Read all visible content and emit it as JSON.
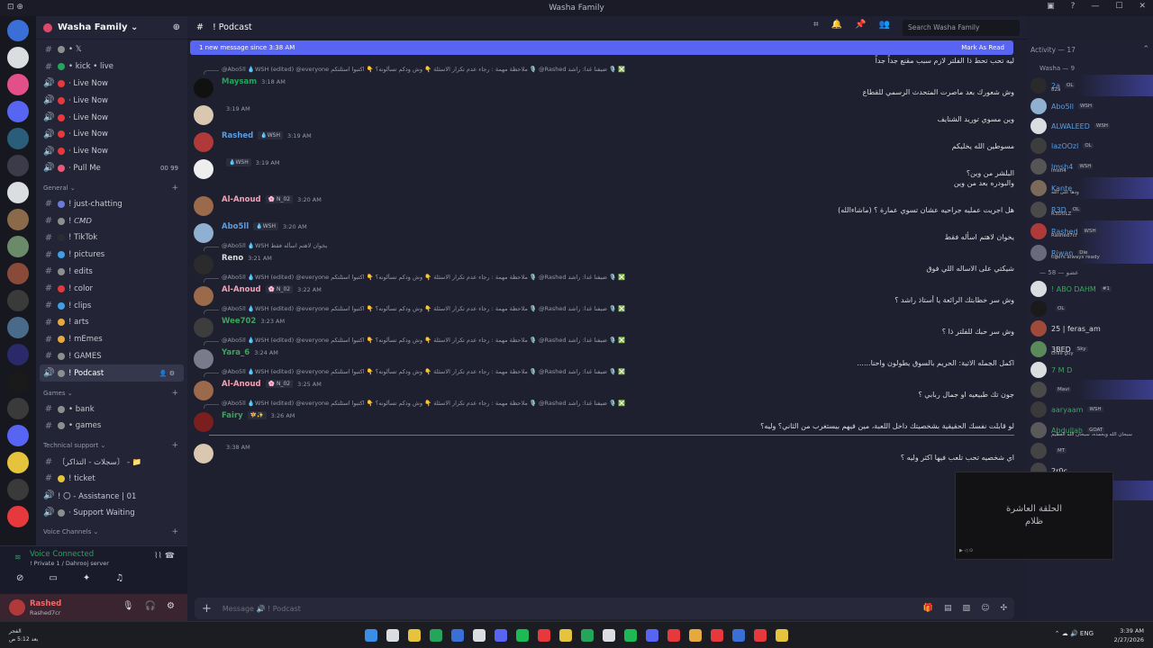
{
  "window": {
    "title": "Washa Family",
    "left_icons": "⊡ ⊕"
  },
  "header": {
    "channel": "! Podcast",
    "search_placeholder": "Search Washa Family"
  },
  "new_messages": {
    "text": "1 new message since 3:38 AM",
    "action": "Mark As Read"
  },
  "guild": {
    "name": "Washa Family ⌄"
  },
  "channels_top": [
    {
      "icon": "#",
      "label": "• 𝕏",
      "emoji": "#8e8e8e"
    },
    {
      "icon": "#",
      "label": "• kick • live",
      "emoji": "#23a55a"
    },
    {
      "icon": "🔊",
      "label": "· Live Now",
      "emoji": "#e5393d"
    },
    {
      "icon": "🔊",
      "label": "· Live Now",
      "emoji": "#e5393d"
    },
    {
      "icon": "🔊",
      "label": "· Live Now",
      "emoji": "#e5393d"
    },
    {
      "icon": "🔊",
      "label": "· Live Now",
      "emoji": "#e5393d"
    },
    {
      "icon": "🔊",
      "label": "· Live Now",
      "emoji": "#e5393d"
    },
    {
      "icon": "🔊",
      "label": "· Pull Me",
      "emoji": "#e75a78",
      "tail": "00  99"
    }
  ],
  "cat_general": "General ⌄",
  "channels_general": [
    {
      "icon": "#",
      "label": "! just-chatting",
      "emoji": "#6c7bd8"
    },
    {
      "icon": "#",
      "label": "! 𝘊𝘔𝘋",
      "emoji": "#8e8e8e"
    },
    {
      "icon": "#",
      "label": "! TikTok",
      "emoji": "#2b2d31"
    },
    {
      "icon": "#",
      "label": "! pictures",
      "emoji": "#3ba0e5"
    },
    {
      "icon": "#",
      "label": "! edits",
      "emoji": "#8e8e8e"
    },
    {
      "icon": "#",
      "label": "! color",
      "emoji": "#e5393d"
    },
    {
      "icon": "#",
      "label": "! clips",
      "emoji": "#3ba0e5"
    },
    {
      "icon": "#",
      "label": "! arts",
      "emoji": "#e5a93d"
    },
    {
      "icon": "#",
      "label": "! mEmes",
      "emoji": "#e5a93d"
    },
    {
      "icon": "#",
      "label": "! GAMES",
      "emoji": "#8e8e8e"
    },
    {
      "icon": "🔊",
      "label": "! Podcast",
      "emoji": "#8e8e8e",
      "active": true
    }
  ],
  "cat_games": "Games ⌄",
  "channels_games": [
    {
      "icon": "#",
      "label": "• bank",
      "emoji": "#8e8e8e"
    },
    {
      "icon": "#",
      "label": "• games",
      "emoji": "#8e8e8e"
    }
  ],
  "cat_support": "Technical support ⌄",
  "channels_support": [
    {
      "icon": "#",
      "label": "〔سجلات - التذاكر〕 - 📁",
      "emoji": ""
    },
    {
      "icon": "#",
      "label": "! ticket",
      "emoji": "#e5c33d"
    },
    {
      "icon": "🔊",
      "label": "! 〇 - Assistance | 01",
      "emoji": ""
    },
    {
      "icon": "🔊",
      "label": "· Support Waiting",
      "emoji": "#8e8e8e"
    }
  ],
  "cat_voice": "Voice Channels ⌄",
  "voice": {
    "title": "Voice Connected",
    "sub": "! Private 1 / Dahrooj server"
  },
  "user": {
    "name": "Rashed",
    "status": "Rashed7cr"
  },
  "messages": [
    {
      "kind": "cont",
      "text": "ليه تحب تحط ذا الفلتر لازم سبب مقنع جداً جداً"
    },
    {
      "kind": "msg",
      "reply": true,
      "name": "Maysam",
      "color": "#23a55a",
      "tags": [],
      "time": "3:18 AM",
      "avatar": "#111111",
      "text": "وش شعورك بعد ماصرت المتحدث الرسمي للقطاع"
    },
    {
      "kind": "msg",
      "reply": false,
      "name": "",
      "color": "#dbdee1",
      "tags": [],
      "time": "3:19 AM",
      "avatar": "#d9c7b0",
      "text": "وين مسوي توريد الشنايف"
    },
    {
      "kind": "msg",
      "reply": false,
      "name": "Rashed",
      "color": "#5c9ddd",
      "tags": [
        "💧WSH"
      ],
      "time": "3:19 AM",
      "avatar": "#b03a3a",
      "text": "مسوطين الله يخليكم"
    },
    {
      "kind": "msg",
      "reply": false,
      "name": "",
      "color": "#e5393d",
      "tags": [
        "💧WSH"
      ],
      "time": "3:19 AM",
      "avatar": "#eeeeee",
      "text": "البلشر من وين؟",
      "text2": "والبودره بعد من وين"
    },
    {
      "kind": "msg",
      "reply": false,
      "name": "Al-Anoud",
      "color": "#f0a3b5",
      "tags": [
        "🌸 N_02"
      ],
      "time": "3:20 AM",
      "avatar": "#9b6a4a",
      "text": "هل اجريت عمليه جراحيه عشان تسوي عمارة ؟ (ماشاءالله)"
    },
    {
      "kind": "msg",
      "reply": false,
      "name": "Abo5ll",
      "color": "#5c9ddd",
      "tags": [
        "💧WSH"
      ],
      "time": "3:20 AM",
      "avatar": "#8fb0d0",
      "text": "يخوان لاهتم اسأله فقط"
    },
    {
      "kind": "msg",
      "reply": true,
      "replyText": "@Abo5ll 💧WSH يخوان لاهتم اسأله فقط",
      "name": "Reno",
      "color": "#dbdee1",
      "tags": [],
      "time": "3:21 AM",
      "avatar": "#2b2b2b",
      "text": "شيكتي على الاساله اللي فوق"
    },
    {
      "kind": "msg",
      "reply": true,
      "name": "Al-Anoud",
      "color": "#f0a3b5",
      "tags": [
        "🌸 N_02"
      ],
      "time": "3:22 AM",
      "avatar": "#9b6a4a",
      "text": "وش سر خطابتك الرائعة يا أستاذ راشد ؟"
    },
    {
      "kind": "msg",
      "reply": true,
      "name": "Wee702",
      "color": "#3ba55c",
      "tags": [],
      "time": "3:23 AM",
      "avatar": "#3d3d3d",
      "text": "وش سر حبك للفلتر ذا ؟"
    },
    {
      "kind": "msg",
      "reply": true,
      "name": "Yara_6",
      "color": "#3ba55c",
      "tags": [],
      "time": "3:24 AM",
      "avatar": "#7a7a8a",
      "text": "اكمل الجمله الاتية: الحريم بالسوق يطولون واحنا......"
    },
    {
      "kind": "msg",
      "reply": true,
      "name": "Al-Anoud",
      "color": "#f0a3b5",
      "tags": [
        "🌸 N_02"
      ],
      "time": "3:25 AM",
      "avatar": "#9b6a4a",
      "text": "جون تك طبيعيه او جمال ربابي ؟"
    },
    {
      "kind": "msg",
      "reply": true,
      "name": "Fairy",
      "color": "#3ba55c",
      "tags": [
        "🧚✨"
      ],
      "time": "3:26 AM",
      "avatar": "#7a1e1e",
      "text": "لو قابلت نفسك الحقيقية بشخصيتك داخل اللعبة، مين فيهم بيستغرب من الثاني؟ وليه؟"
    },
    {
      "kind": "msg",
      "reply": false,
      "name": "",
      "color": "#dbdee1",
      "tags": [],
      "time": "3:38 AM",
      "avatar": "#d9c7b0",
      "text": "اي شخصيه تحب تلعب فيها اكثر وليه ؟",
      "divider": true
    }
  ],
  "reply_default": "@Abo5ll 💧WSH (edited) @everyone ملاحظة مهمة : رجاء عدم تكرار الاسئلة 👇 وش ودكم تسألونه؟ 👇 اكتبوا اسئلتكم 🎙️ @Rashed ضيفنا غدا: راشد 🎙️ ❎",
  "composer": {
    "placeholder": "Message 🔊 ! Podcast"
  },
  "members_header": "Activity — 17",
  "role1": "Washa — 9",
  "members1": [
    {
      "name": "2a",
      "tag": "OL",
      "color": "#5c9ddd",
      "status": "82a",
      "av": "#2a2a2a",
      "boost": true
    },
    {
      "name": "Abo5ll",
      "tag": "WSH",
      "color": "#5c9ddd",
      "status": "",
      "av": "#8fb0d0"
    },
    {
      "name": "ALWALEED",
      "tag": "WSH",
      "color": "#5c9ddd",
      "status": "",
      "av": "#dbdee1"
    },
    {
      "name": "lazOOzl",
      "tag": "OL",
      "color": "#5c9ddd",
      "status": "",
      "av": "#3d3d3d"
    },
    {
      "name": "lmsh4",
      "tag": "WSH",
      "color": "#5c9ddd",
      "status": "lmsh4",
      "av": "#555555"
    },
    {
      "name": "Kante",
      "tag": "",
      "color": "#5c9ddd",
      "status": "ودها على الله",
      "av": "#7a6a5a",
      "boost": true
    },
    {
      "name": "R3D",
      "tag": "OL",
      "color": "#5c9ddd",
      "status": "R3DULZ",
      "av": "#4a4a4a"
    },
    {
      "name": "Rashed",
      "tag": "WSH",
      "color": "#5c9ddd",
      "status": "Rashed7cr",
      "av": "#b03a3a",
      "boost": true
    },
    {
      "name": "Rjwan",
      "tag": "Die",
      "color": "#5c9ddd",
      "status": "tigers always ready",
      "av": "#6a6a7a",
      "boost": true
    }
  ],
  "role2": "— عضو — 58",
  "members2": [
    {
      "name": "! ABO DAHM",
      "tag": "#1",
      "color": "#3ba55c",
      "status": "",
      "av": "#dbdee1"
    },
    {
      "name": "",
      "tag": "OL",
      "color": "#5865f2",
      "status": "",
      "av": "#1a1a1a"
    },
    {
      "name": "25 | feras_am",
      "tag": "",
      "color": "#dbdee1",
      "status": "",
      "av": "#a04a3a"
    },
    {
      "name": "3BED",
      "tag": "Sky",
      "color": "#dbdee1",
      "status": "chilli guy",
      "av": "#5a8a5a"
    },
    {
      "name": "7 M D",
      "tag": "",
      "color": "#3ba55c",
      "status": "",
      "av": "#dbdee1"
    },
    {
      "name": "",
      "tag": "Mavi",
      "color": "#5865f2",
      "status": "",
      "av": "#4a4a4a",
      "boost": true
    },
    {
      "name": "aaryaam",
      "tag": "WSH",
      "color": "#3ba55c",
      "status": "",
      "av": "#3a3a3a"
    },
    {
      "name": "Abdullah",
      "tag": "GOAT",
      "color": "#3ba55c",
      "status": "سبحان الله وبحمده، سبحان الله العظيم",
      "av": "#5a5a5a"
    },
    {
      "name": "",
      "tag": "MT",
      "color": "#3ba55c",
      "status": "",
      "av": "#444444"
    },
    {
      "name": "2r0c",
      "tag": "",
      "color": "#dbdee1",
      "status": "",
      "av": "#444444"
    },
    {
      "name": "anas",
      "tag": "OST",
      "color": "#dbdee1",
      "status": "",
      "av": "#555555",
      "boost": true
    },
    {
      "name": "Ashwaq",
      "tag": "DEI",
      "color": "#3ba55c",
      "status": "",
      "av": "#777777"
    },
    {
      "name": "Be5",
      "tag": "",
      "color": "#3ba55c",
      "status": "",
      "av": "#444444"
    }
  ],
  "pip": {
    "line1": "الحلقة العاشرة",
    "line2": "ظلام"
  },
  "clock": {
    "time": "3:39 AM",
    "date": "2/27/2026"
  },
  "taskbar_left": {
    "line1": "الفجر",
    "line2": "بعد 5:12 ص"
  },
  "tray": "⌃  ☁  🔊  ENG"
}
